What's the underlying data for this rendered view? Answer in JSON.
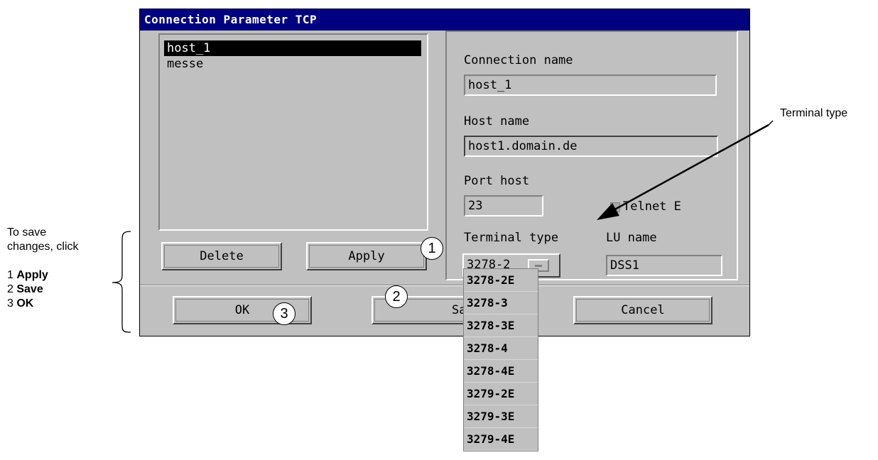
{
  "dialog": {
    "title": "Connection Parameter TCP",
    "connections": [
      "host_1",
      "messe"
    ],
    "selected_connection": "host_1",
    "fields": {
      "connection_name_label": "Connection name",
      "connection_name_value": "host_1",
      "host_name_label": "Host name",
      "host_name_value": "host1.domain.de",
      "port_host_label": "Port host",
      "port_host_value": "23",
      "telnet_label": "Telnet E",
      "terminal_type_label": "Terminal type",
      "terminal_type_value": "3278-2",
      "lu_name_label": "LU name",
      "lu_name_value": "DSS1"
    },
    "buttons": {
      "delete": "Delete",
      "apply": "Apply",
      "ok": "OK",
      "save": "Save",
      "cancel": "Cancel"
    },
    "terminal_options": [
      "3278-2E",
      "3278-3",
      "3278-3E",
      "3278-4",
      "3278-4E",
      "3279-2E",
      "3279-3E",
      "3279-4E"
    ]
  },
  "annotations": {
    "terminal_type_callout": "Terminal type",
    "instructions_line1": "To save",
    "instructions_line2": "changes, click",
    "step1_num": "1",
    "step1_word": "Apply",
    "step2_num": "2",
    "step2_word": "Save",
    "step3_num": "3",
    "step3_word": "OK",
    "marker1": "1",
    "marker2": "2",
    "marker3": "3"
  }
}
